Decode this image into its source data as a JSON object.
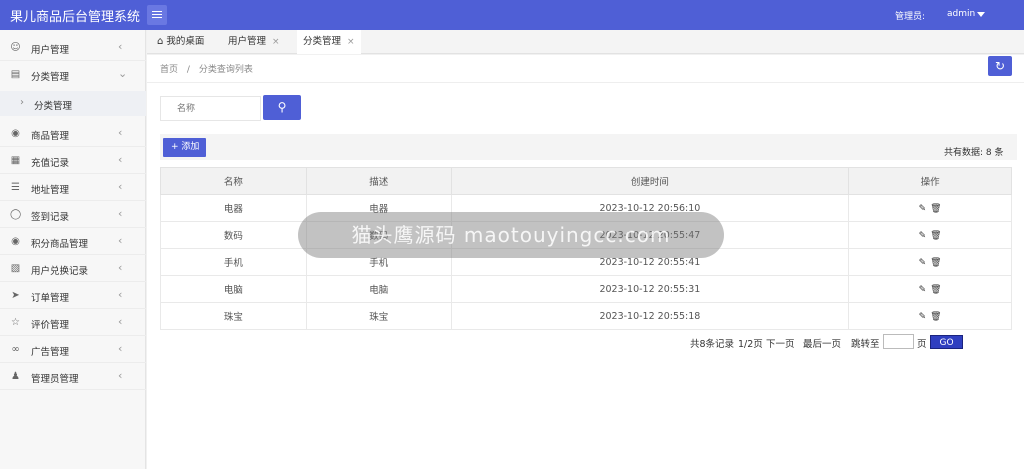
{
  "app": {
    "title": "果儿商品后台管理系统",
    "admin_label": "管理员:",
    "admin_name": "admin"
  },
  "sidebar": {
    "items": [
      {
        "label": "用户管理",
        "icon": "user-icon"
      },
      {
        "label": "分类管理",
        "icon": "category-icon",
        "expanded": true,
        "children": [
          {
            "label": "分类管理"
          }
        ]
      },
      {
        "label": "商品管理",
        "icon": "palette-icon"
      },
      {
        "label": "充值记录",
        "icon": "calendar-icon"
      },
      {
        "label": "地址管理",
        "icon": "layers-icon"
      },
      {
        "label": "签到记录",
        "icon": "shield-icon"
      },
      {
        "label": "积分商品管理",
        "icon": "palette-icon"
      },
      {
        "label": "用户兑换记录",
        "icon": "document-icon"
      },
      {
        "label": "订单管理",
        "icon": "send-icon"
      },
      {
        "label": "评价管理",
        "icon": "star-icon"
      },
      {
        "label": "广告管理",
        "icon": "link-icon"
      },
      {
        "label": "管理员管理",
        "icon": "person-icon"
      }
    ]
  },
  "tabs": [
    {
      "label": "我的桌面",
      "icon": "home-icon"
    },
    {
      "label": "用户管理",
      "close": "×"
    },
    {
      "label": "分类管理",
      "close": "×",
      "active": true
    }
  ],
  "breadcrumb": {
    "home": "首页",
    "sep": "/",
    "current": "分类查询列表"
  },
  "search": {
    "placeholder": "名称"
  },
  "toolbar": {
    "add_label": "添加",
    "total_label": "共有数据: 8 条"
  },
  "table": {
    "headers": [
      "名称",
      "描述",
      "创建时间",
      "操作"
    ],
    "rows": [
      [
        "电器",
        "电器",
        "2023-10-12 20:56:10"
      ],
      [
        "数码",
        "数码",
        "2023-10-12 20:55:47"
      ],
      [
        "手机",
        "手机",
        "2023-10-12 20:55:41"
      ],
      [
        "电脑",
        "电脑",
        "2023-10-12 20:55:31"
      ],
      [
        "珠宝",
        "珠宝",
        "2023-10-12 20:55:18"
      ]
    ]
  },
  "pager": {
    "total_records": "共8条记录",
    "page_info": "1/2页",
    "next": "下一页",
    "last": "最后一页",
    "jump_to": "跳转至",
    "page_unit": "页",
    "go": "GO"
  },
  "watermark": {
    "text": "猫头鹰源码 maotouyingcc.com"
  },
  "colors": {
    "primary": "#4f5fd6",
    "go": "#2f3fc0"
  }
}
